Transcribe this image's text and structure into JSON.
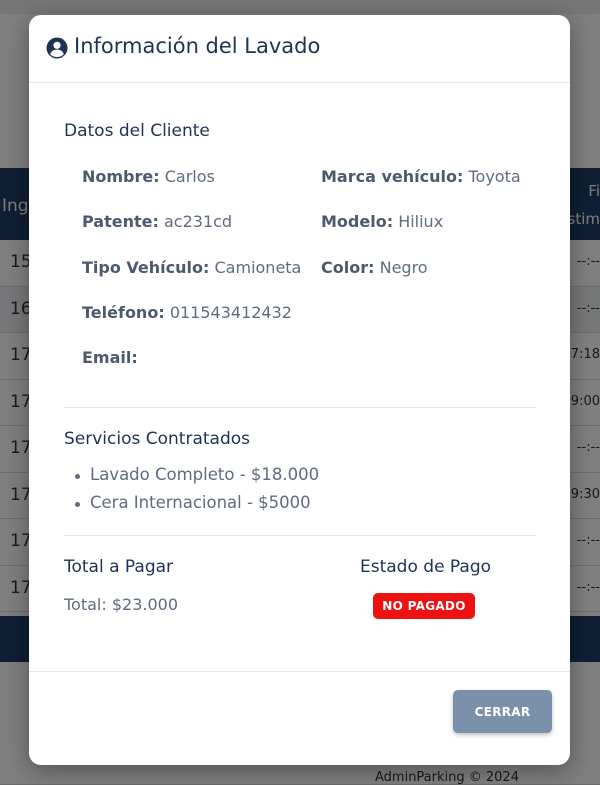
{
  "background": {
    "table_header_left": "Ingr",
    "table_header_right_line1": "Fi",
    "table_header_right_line2": "stim",
    "rows": [
      {
        "left": "15",
        "right": "--:--"
      },
      {
        "left": "16",
        "right": "--:--"
      },
      {
        "left": "17",
        "right": "7:18"
      },
      {
        "left": "17",
        "right": "9:00"
      },
      {
        "left": "17",
        "right": "--:--"
      },
      {
        "left": "17",
        "right": "9:30"
      },
      {
        "left": "17",
        "right": "--:--"
      },
      {
        "left": "17",
        "right": "--:--"
      }
    ],
    "footer_text": "AdminParking © 2024"
  },
  "modal": {
    "title": "Información del Lavado",
    "client_section_title": "Datos del Cliente",
    "fields": {
      "nombre_label": "Nombre:",
      "nombre_value": "Carlos",
      "patente_label": "Patente:",
      "patente_value": "ac231cd",
      "tipo_label": "Tipo Vehículo:",
      "tipo_value": "Camioneta",
      "telefono_label": "Teléfono:",
      "telefono_value": "011543412432",
      "email_label": "Email:",
      "email_value": "",
      "marca_label": "Marca vehículo:",
      "marca_value": "Toyota",
      "modelo_label": "Modelo:",
      "modelo_value": "Hiliux",
      "color_label": "Color:",
      "color_value": "Negro"
    },
    "services_title": "Servicios Contratados",
    "services": [
      "Lavado Completo - $18.000",
      "Cera Internacional - $5000"
    ],
    "total_title": "Total a Pagar",
    "total_value": "Total: $23.000",
    "payment_status_title": "Estado de Pago",
    "payment_status": "NO PAGADO",
    "close_label": "CERRAR"
  },
  "colors": {
    "title": "#1e3354",
    "badge": "#ee1111",
    "close_button": "#7b90aa",
    "table_header": "#1f3d66"
  }
}
